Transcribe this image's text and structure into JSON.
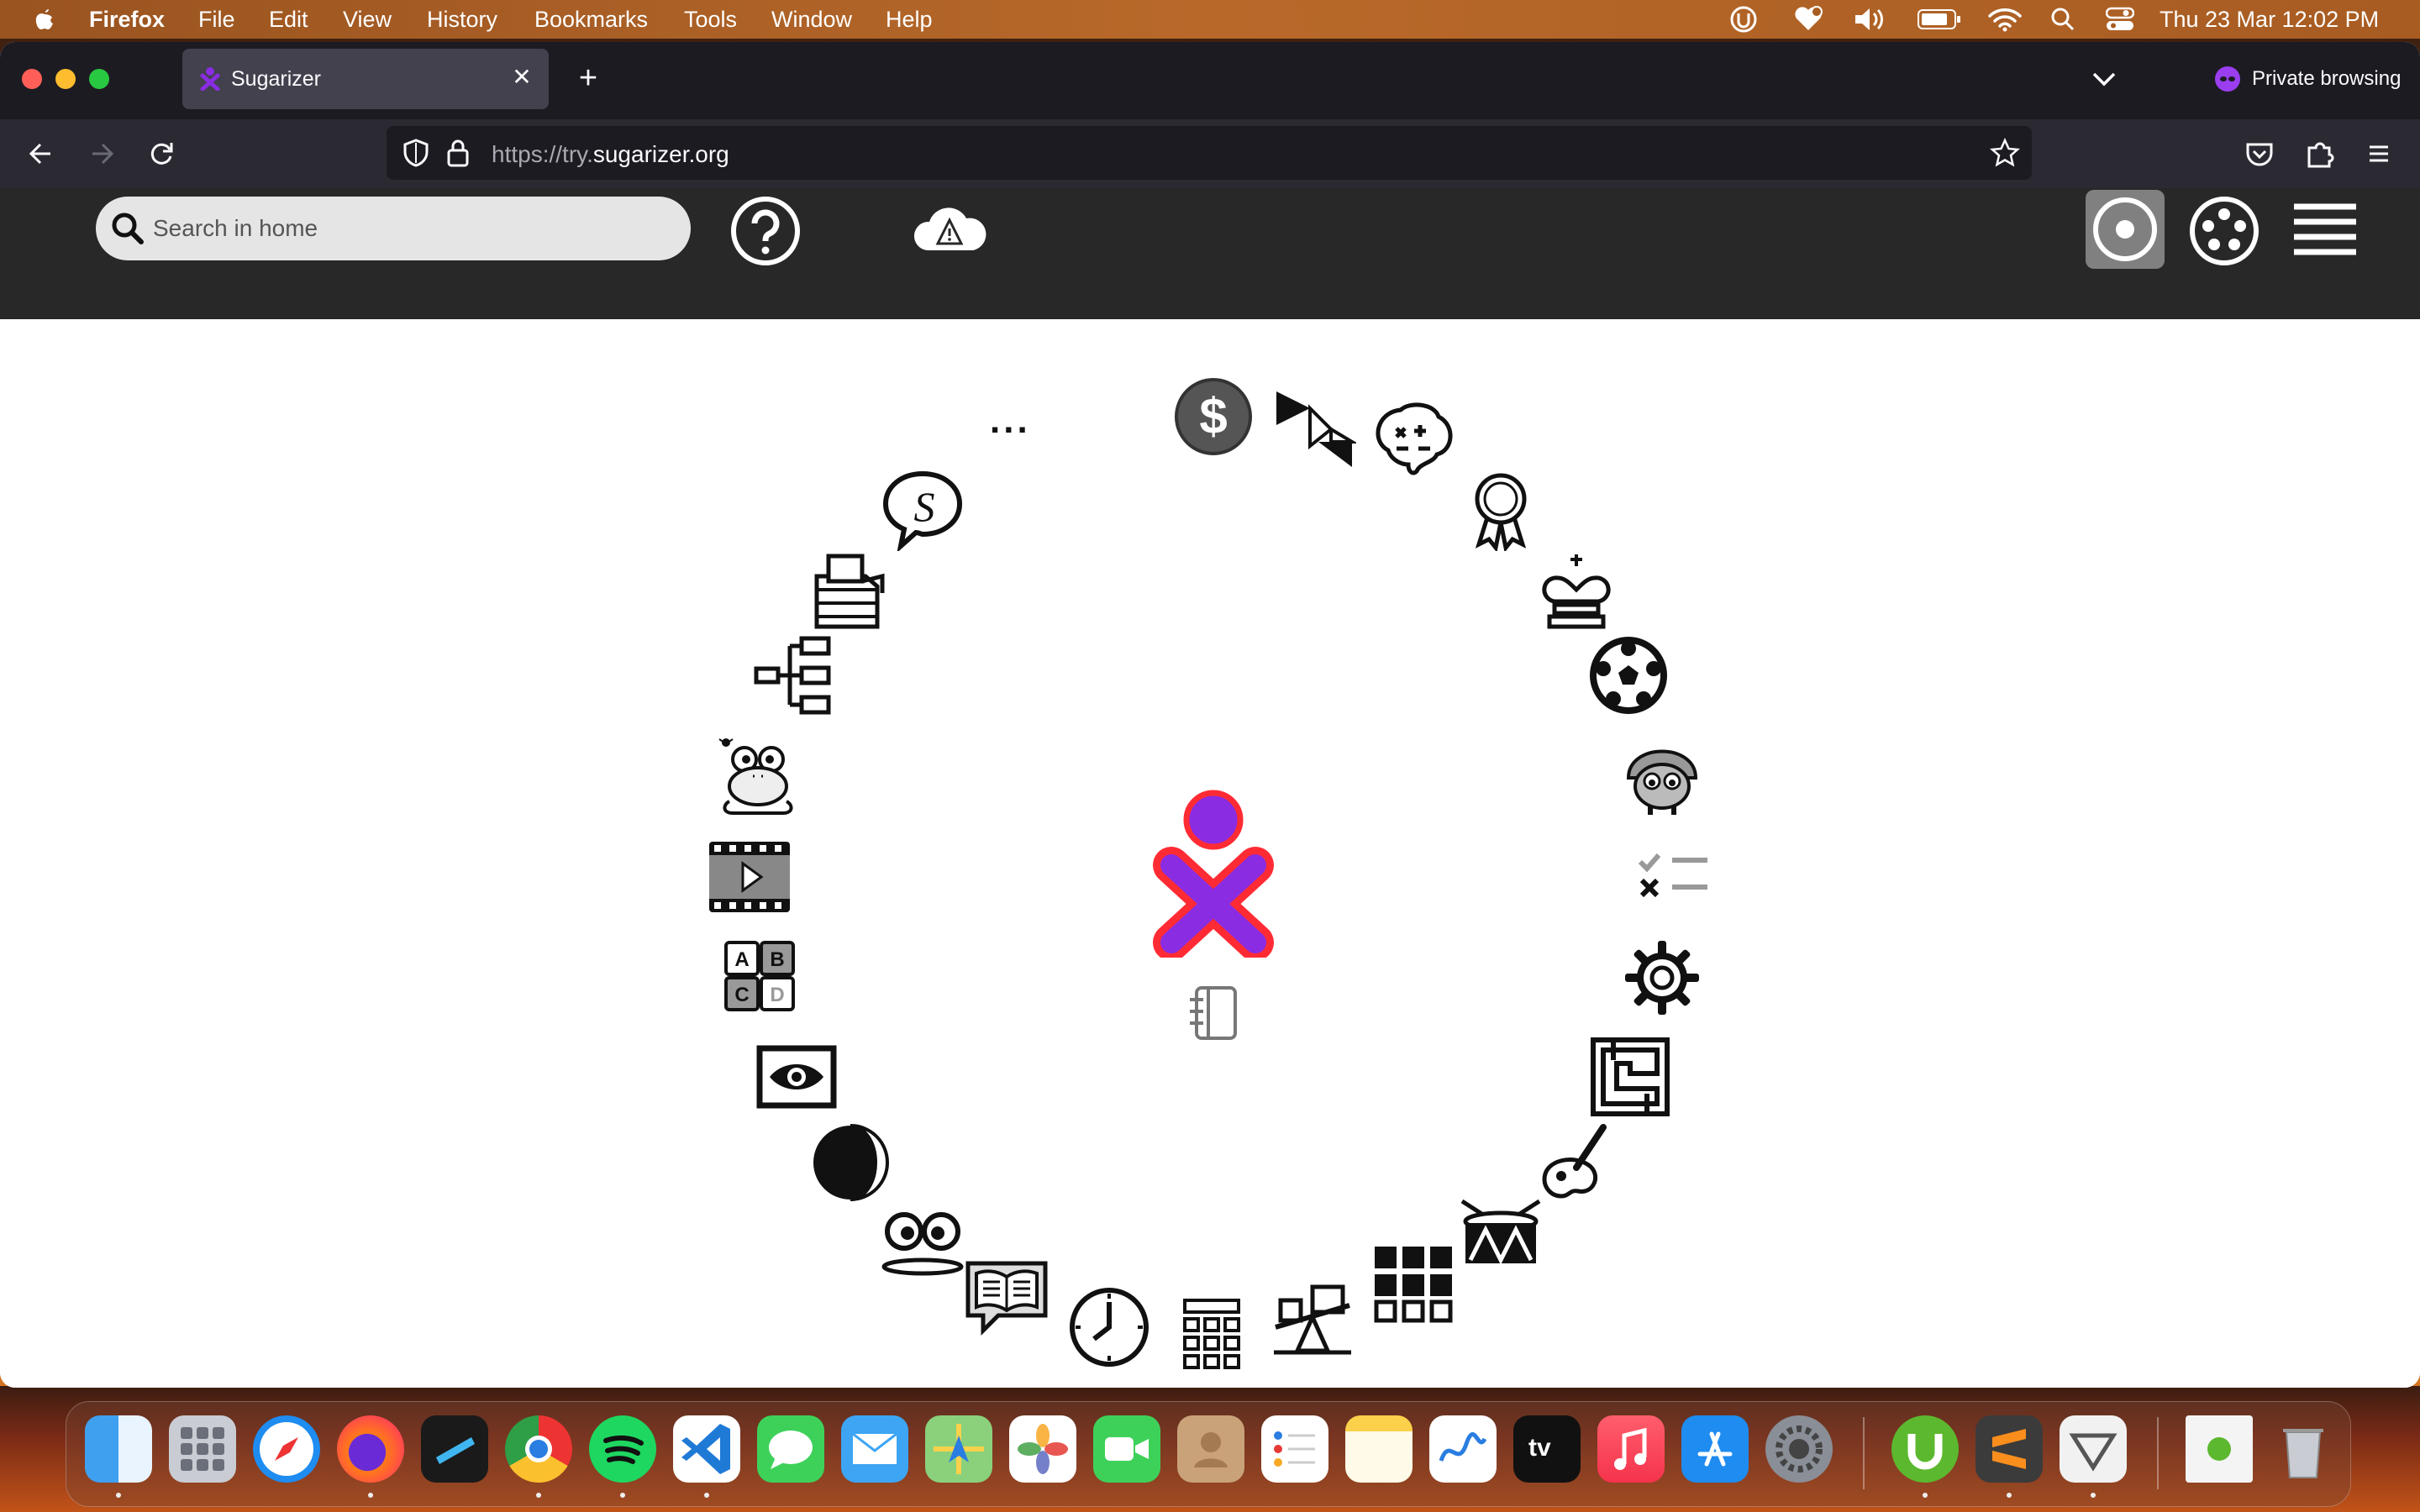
{
  "menubar": {
    "app_name": "Firefox",
    "items": [
      "File",
      "Edit",
      "View",
      "History",
      "Bookmarks",
      "Tools",
      "Window",
      "Help"
    ],
    "clock": "Thu 23 Mar  12:02 PM"
  },
  "browser": {
    "tab_title": "Sugarizer",
    "url_prefix": "https://try.",
    "url_domain": "sugarizer.org",
    "private_label": "Private browsing"
  },
  "sugarizer": {
    "search_placeholder": "Search in home",
    "more_label": "...",
    "xo_colors": {
      "stroke": "#ff2b34",
      "fill": "#8a2ce2"
    },
    "activities": [
      "money-icon",
      "tangram-icon",
      "math-brain-icon",
      "award-icon",
      "chess-icon",
      "soccer-ball-icon",
      "mushroom-character-icon",
      "quiz-icon",
      "settings-gear-icon",
      "maze-icon",
      "paint-icon",
      "drum-icon",
      "blocks-grid-icon",
      "seesaw-icon",
      "calculator-icon",
      "clock-icon",
      "book-reader-icon",
      "speak-eyes-icon",
      "moon-icon",
      "eye-icon",
      "abcd-icon",
      "video-player-icon",
      "frog-icon",
      "mindmap-icon",
      "records-stack-icon",
      "speech-s-icon"
    ]
  },
  "dock": {
    "apps": [
      "Finder",
      "Launchpad",
      "Safari",
      "Firefox",
      "Notchmeister",
      "Chrome",
      "Spotify",
      "VS Code",
      "Messages",
      "Mail",
      "Maps",
      "Photos",
      "FaceTime",
      "Contacts",
      "Reminders",
      "Notes",
      "Freeform",
      "TV",
      "Music",
      "App Store",
      "System Settings",
      "uTorrent",
      "Sublime Text",
      "Preview",
      "Torrent file",
      "Trash"
    ],
    "tv_label": "tv"
  },
  "colors": {
    "menubar": "#a85c22",
    "tabstrip": "#1c1b22",
    "navbar": "#2b2a33",
    "sugar_toolbar": "#282828"
  }
}
